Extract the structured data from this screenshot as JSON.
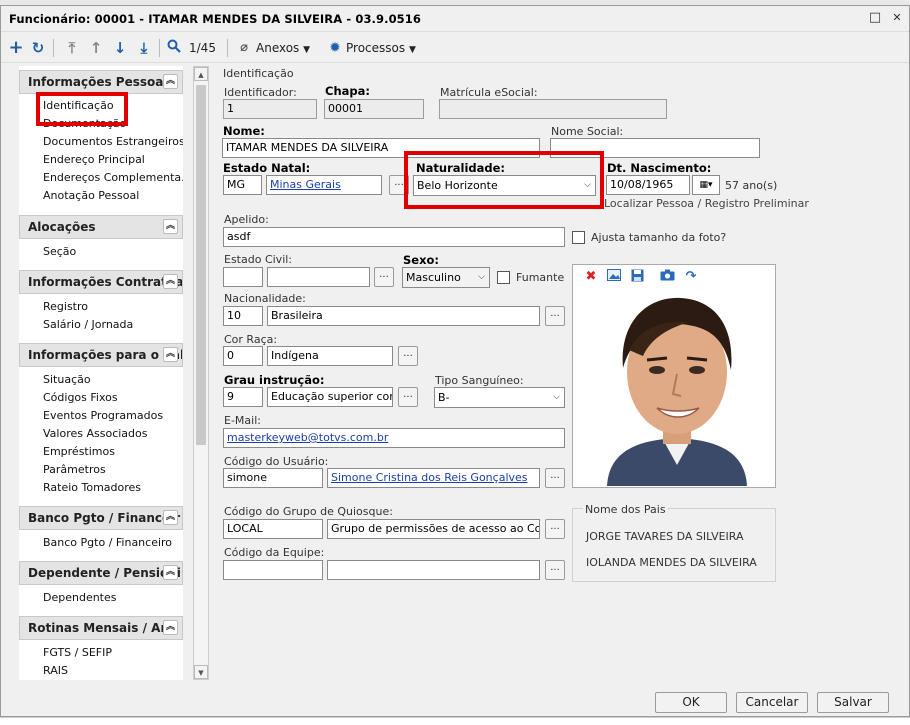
{
  "window": {
    "title": "Funcionário: 00001 - ITAMAR MENDES DA SILVEIRA - 03.9.0516",
    "restore_glyph": "□",
    "close_glyph": "✕"
  },
  "toolbar": {
    "record_position": "1/45",
    "anexos_label": "Anexos",
    "processos_label": "Processos",
    "icons": [
      "plus-icon",
      "refresh-icon",
      "first-icon",
      "prev-icon",
      "next-icon",
      "last-icon",
      "search-icon",
      "paperclip-icon",
      "gear-icon"
    ],
    "accent": "#1f5fa8"
  },
  "sidebar": {
    "sections": [
      {
        "title": "Informações Pessoais",
        "items": [
          "Identificação",
          "Documentação",
          "Documentos Estrangeiros",
          "Endereço Principal",
          "Endereços Complementa...",
          "Anotação Pessoal"
        ]
      },
      {
        "title": "Alocações",
        "items": [
          "Seção"
        ]
      },
      {
        "title": "Informações Contratuai",
        "items": [
          "Registro",
          "Salário / Jornada"
        ]
      },
      {
        "title": "Informações para o Cál",
        "items": [
          "Situação",
          "Códigos Fixos",
          "Eventos Programados",
          "Valores Associados",
          "Empréstimos",
          "Parâmetros",
          "Rateio Tomadores"
        ]
      },
      {
        "title": "Banco Pgto / Financeir",
        "items": [
          "Banco Pgto / Financeiro"
        ]
      },
      {
        "title": "Dependente / Pensioni",
        "items": [
          "Dependentes"
        ]
      },
      {
        "title": "Rotinas Mensais / Anu",
        "items": [
          "FGTS / SEFIP",
          "RAIS"
        ]
      }
    ],
    "collapse_glyph": "︽"
  },
  "form": {
    "group_label": "Identificação",
    "identificador": {
      "label": "Identificador:",
      "value": "1"
    },
    "chapa": {
      "label": "Chapa:",
      "value": "00001"
    },
    "matricula": {
      "label": "Matrícula eSocial:",
      "value": ""
    },
    "nome": {
      "label": "Nome:",
      "value": "ITAMAR MENDES DA SILVEIRA"
    },
    "nome_social": {
      "label": "Nome Social:",
      "value": ""
    },
    "estado_natal": {
      "label": "Estado Natal:",
      "code": "MG",
      "name": "Minas Gerais"
    },
    "naturalidade": {
      "label": "Naturalidade:",
      "value": "Belo Horizonte"
    },
    "nascimento": {
      "label": "Dt. Nascimento:",
      "value": "10/08/1965",
      "age": "57 ano(s)",
      "link": "Localizar Pessoa / Registro Preliminar"
    },
    "apelido": {
      "label": "Apelido:",
      "value": "asdf"
    },
    "ajusta_foto": "Ajusta tamanho da foto?",
    "estado_civil": {
      "label": "Estado Civil:",
      "code": "",
      "name": ""
    },
    "sexo": {
      "label": "Sexo:",
      "value": "Masculino"
    },
    "fumante": "Fumante",
    "nacionalidade": {
      "label": "Nacionalidade:",
      "code": "10",
      "name": "Brasileira"
    },
    "cor_raca": {
      "label": "Cor Raça:",
      "code": "0",
      "name": "Indígena"
    },
    "grau_instrucao": {
      "label": "Grau instrução:",
      "code": "9",
      "name": "Educação superior compl"
    },
    "tipo_sanguineo": {
      "label": "Tipo Sanguíneo:",
      "value": "B-"
    },
    "email": {
      "label": "E-Mail:",
      "value": "masterkeyweb@totvs.com.br"
    },
    "codigo_usuario": {
      "label": "Código do Usuário:",
      "code": "simone",
      "name": "Simone Cristina dos Reis Gonçalves"
    },
    "grupo_quiosque": {
      "label": "Código do Grupo de Quiosque:",
      "code": "LOCAL",
      "name": "Grupo de permissões de acesso ao Corporel"
    },
    "codigo_equipe": {
      "label": "Código da Equipe:",
      "code": "",
      "name": ""
    },
    "ellipsis": "...",
    "dropdown_glyph": "⌵"
  },
  "parents": {
    "label": "Nome dos Pais",
    "father": "JORGE TAVARES DA SILVEIRA",
    "mother": "IOLANDA  MENDES DA SILVEIRA"
  },
  "buttons": {
    "ok": "OK",
    "cancel": "Cancelar",
    "save": "Salvar"
  },
  "highlight_color": "#e00000"
}
